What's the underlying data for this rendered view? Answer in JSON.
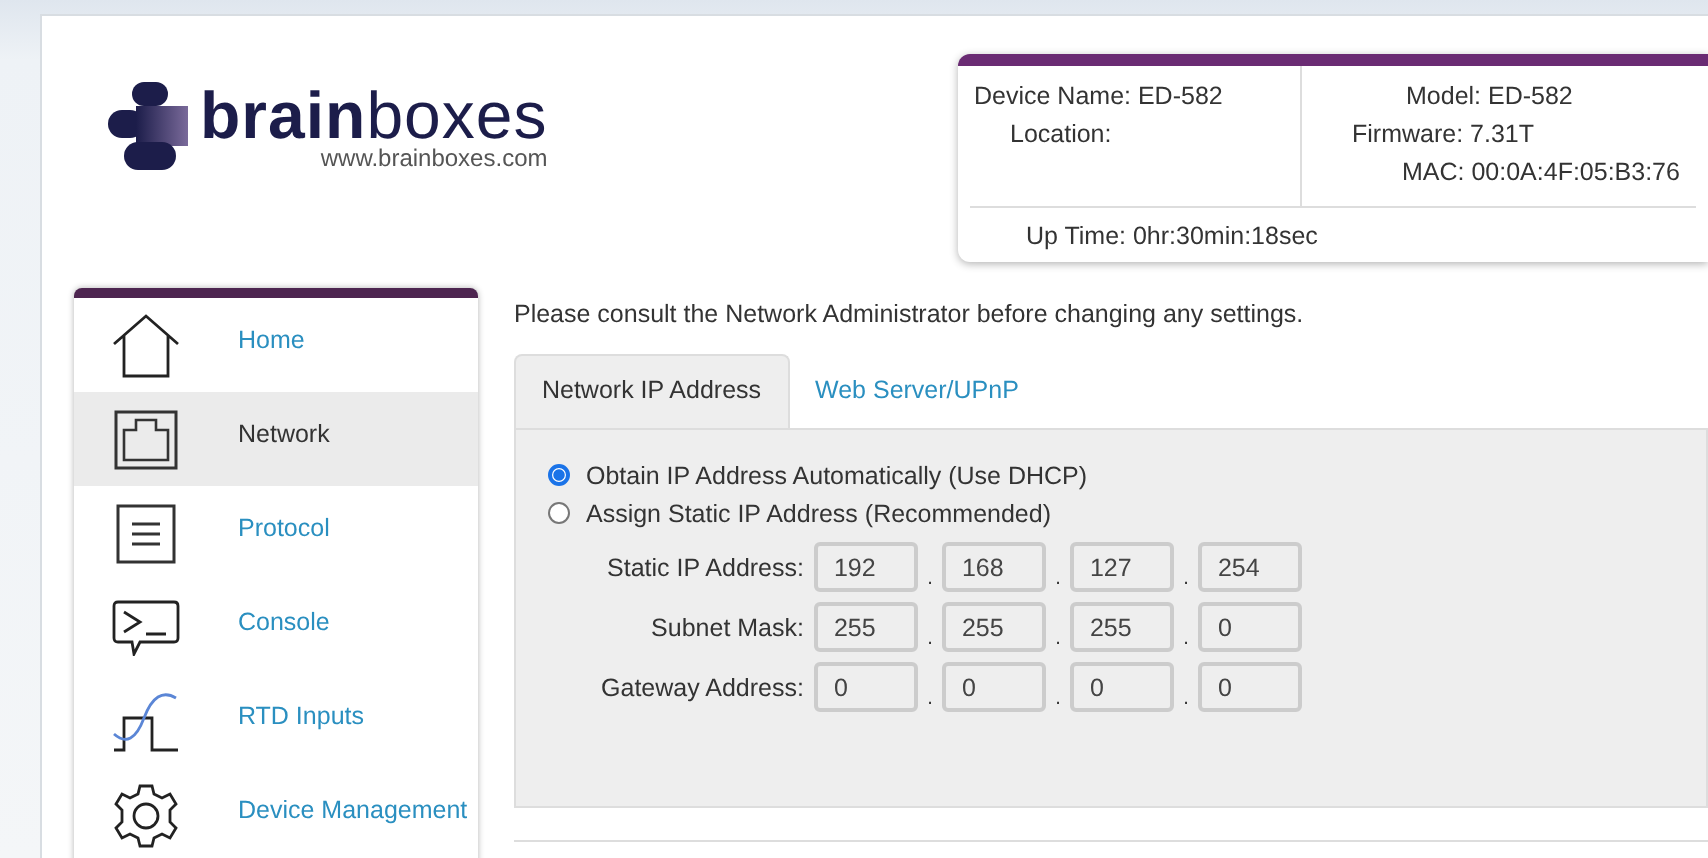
{
  "logo": {
    "brand": "**brain**boxes",
    "url": "www.brainboxes.com"
  },
  "device_info": {
    "device_name": "Device Name: ED-582",
    "location": "Location:",
    "model": "Model: ED-582",
    "firmware": "Firmware: 7.31T",
    "mac": "MAC: 00:0A:4F:05:B3:76",
    "up_time": "Up Time: 0hr:30min:18sec"
  },
  "sidebar": {
    "items": [
      {
        "label": "Home",
        "selected": false
      },
      {
        "label": "Network",
        "selected": true
      },
      {
        "label": "Protocol",
        "selected": false
      },
      {
        "label": "Console",
        "selected": false
      },
      {
        "label": "RTD Inputs",
        "selected": false
      },
      {
        "label": "Device Management",
        "selected": false
      }
    ]
  },
  "notice": "Please consult the Network Administrator before changing any settings.",
  "tabs": [
    {
      "label": "Network IP Address",
      "selected": true
    },
    {
      "label": "Web Server/UPnP",
      "selected": false
    }
  ],
  "ip_mode": [
    {
      "label": "Obtain IP Address Automatically (Use DHCP)",
      "selected": true
    },
    {
      "label": "Assign Static IP Address (Recommended)",
      "selected": false
    }
  ],
  "address_fields": [
    {
      "label": "Static IP Address:",
      "octets": [
        "192",
        "168",
        "127",
        "254"
      ],
      "separators": [
        ".",
        ".",
        "."
      ]
    },
    {
      "label": "Subnet Mask:",
      "octets": [
        "255",
        "255",
        "255",
        "0"
      ],
      "separators": [
        ".",
        ".",
        "."
      ]
    },
    {
      "label": "Gateway Address:",
      "octets": [
        "0",
        "0",
        "0",
        "0"
      ],
      "separators": [
        ".",
        ".",
        "."
      ]
    }
  ]
}
